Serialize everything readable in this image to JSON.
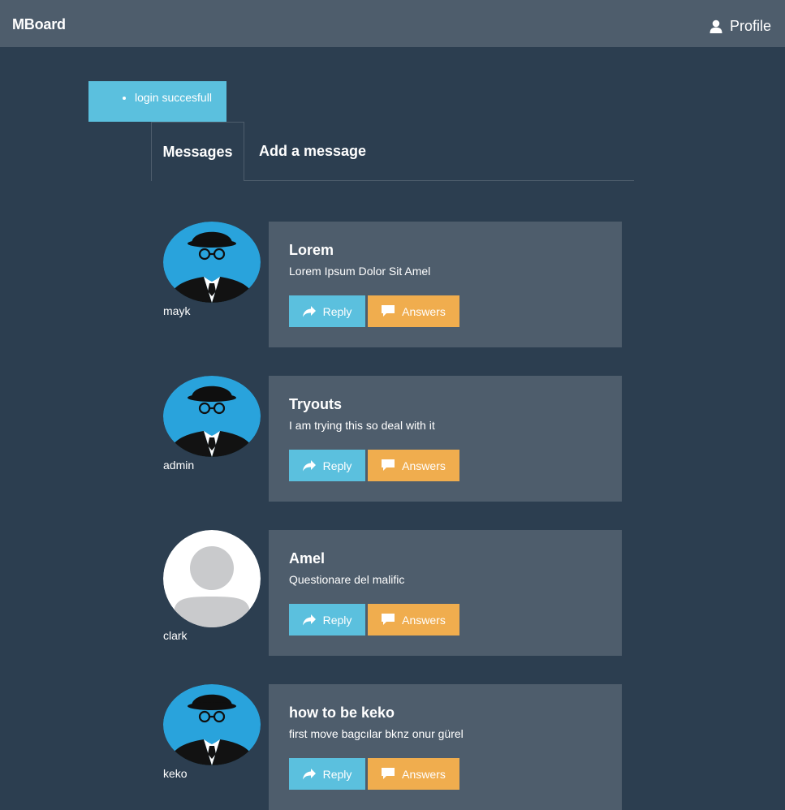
{
  "navbar": {
    "brand": "MBoard",
    "profile_label": "Profile",
    "profile_icon": "user-icon"
  },
  "alert": {
    "items": [
      "login succesfull"
    ]
  },
  "tabs": [
    {
      "label": "Messages",
      "active": true
    },
    {
      "label": "Add a message",
      "active": false
    }
  ],
  "messages": [
    {
      "username": "mayk",
      "avatar": "gentleman-avatar",
      "title": "Lorem",
      "body": "Lorem Ipsum Dolor Sit Amel",
      "reply_label": "Reply",
      "answers_label": "Answers"
    },
    {
      "username": "admin",
      "avatar": "gentleman-avatar",
      "title": "Tryouts",
      "body": "I am trying this so deal with it",
      "reply_label": "Reply",
      "answers_label": "Answers"
    },
    {
      "username": "clark",
      "avatar": "default-user-avatar",
      "title": "Amel",
      "body": "Questionare del malific",
      "reply_label": "Reply",
      "answers_label": "Answers"
    },
    {
      "username": "keko",
      "avatar": "gentleman-avatar",
      "title": "how to be keko",
      "body": "first move bagcılar bknz onur gürel",
      "reply_label": "Reply",
      "answers_label": "Answers"
    }
  ],
  "colors": {
    "background": "#2c3e50",
    "navbar": "#4e5d6c",
    "card": "#4e5d6c",
    "info": "#5bc0de",
    "warning": "#f0ad4e",
    "avatar_blue": "#29a3dc"
  }
}
